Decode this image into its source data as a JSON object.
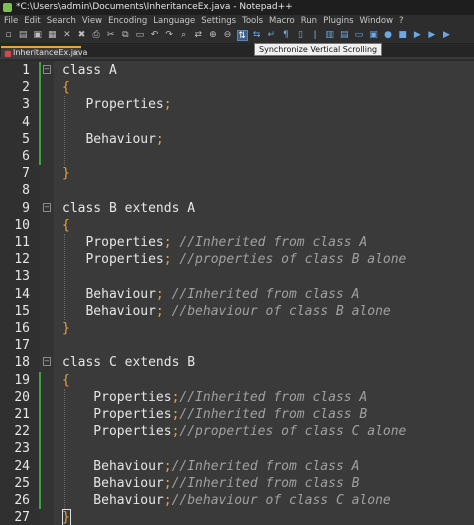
{
  "window": {
    "title": "*C:\\Users\\admin\\Documents\\InheritanceEx.java - Notepad++"
  },
  "menu": [
    "File",
    "Edit",
    "Search",
    "View",
    "Encoding",
    "Language",
    "Settings",
    "Tools",
    "Macro",
    "Run",
    "Plugins",
    "Window",
    "?"
  ],
  "tooltip": "Synchronize Vertical Scrolling",
  "tab": {
    "label": "InheritanceEx.java"
  },
  "colors": {
    "accent": "#e8a33d",
    "change_bar": "#3aa53a",
    "background": "#3a3a3a"
  },
  "lines": [
    {
      "n": "1",
      "fold": "minus",
      "tokens": [
        [
          "kw",
          "class A"
        ]
      ]
    },
    {
      "n": "2",
      "fold": "",
      "tokens": [
        [
          "br",
          "{"
        ]
      ]
    },
    {
      "n": "3",
      "fold": "",
      "tokens": [
        [
          "t",
          "   Properties"
        ],
        [
          "semi",
          ";"
        ]
      ]
    },
    {
      "n": "4",
      "fold": "",
      "tokens": []
    },
    {
      "n": "5",
      "fold": "",
      "tokens": [
        [
          "t",
          "   Behaviour"
        ],
        [
          "semi",
          ";"
        ]
      ]
    },
    {
      "n": "6",
      "fold": "",
      "tokens": []
    },
    {
      "n": "7",
      "fold": "",
      "tokens": [
        [
          "br",
          "}"
        ]
      ]
    },
    {
      "n": "8",
      "fold": "",
      "tokens": []
    },
    {
      "n": "9",
      "fold": "minus",
      "tokens": [
        [
          "kw",
          "class B extends A"
        ]
      ]
    },
    {
      "n": "10",
      "fold": "",
      "tokens": [
        [
          "br",
          "{"
        ]
      ]
    },
    {
      "n": "11",
      "fold": "",
      "tokens": [
        [
          "t",
          "   Properties"
        ],
        [
          "semi",
          ";"
        ],
        [
          "cm",
          " //Inherited from class A"
        ]
      ]
    },
    {
      "n": "12",
      "fold": "",
      "tokens": [
        [
          "t",
          "   Properties"
        ],
        [
          "semi",
          ";"
        ],
        [
          "cm",
          " //properties of class B alone"
        ]
      ]
    },
    {
      "n": "13",
      "fold": "",
      "tokens": []
    },
    {
      "n": "14",
      "fold": "",
      "tokens": [
        [
          "t",
          "   Behaviour"
        ],
        [
          "semi",
          ";"
        ],
        [
          "cm",
          " //Inherited from class A"
        ]
      ]
    },
    {
      "n": "15",
      "fold": "",
      "tokens": [
        [
          "t",
          "   Behaviour"
        ],
        [
          "semi",
          ";"
        ],
        [
          "cm",
          " //behaviour of class B alone"
        ]
      ]
    },
    {
      "n": "16",
      "fold": "",
      "tokens": [
        [
          "br",
          "}"
        ]
      ]
    },
    {
      "n": "17",
      "fold": "",
      "tokens": []
    },
    {
      "n": "18",
      "fold": "minus",
      "tokens": [
        [
          "kw",
          "class C extends B"
        ]
      ]
    },
    {
      "n": "19",
      "fold": "",
      "tokens": [
        [
          "br",
          "{"
        ]
      ]
    },
    {
      "n": "20",
      "fold": "",
      "tokens": [
        [
          "t",
          "    Properties"
        ],
        [
          "semi",
          ";"
        ],
        [
          "cm",
          "//Inherited from class A"
        ]
      ]
    },
    {
      "n": "21",
      "fold": "",
      "tokens": [
        [
          "t",
          "    Properties"
        ],
        [
          "semi",
          ";"
        ],
        [
          "cm",
          "//Inherited from class B"
        ]
      ]
    },
    {
      "n": "22",
      "fold": "",
      "tokens": [
        [
          "t",
          "    Properties"
        ],
        [
          "semi",
          ";"
        ],
        [
          "cm",
          "//properties of class C alone"
        ]
      ]
    },
    {
      "n": "23",
      "fold": "",
      "tokens": []
    },
    {
      "n": "24",
      "fold": "",
      "tokens": [
        [
          "t",
          "    Behaviour"
        ],
        [
          "semi",
          ";"
        ],
        [
          "cm",
          "//Inherited from class A"
        ]
      ]
    },
    {
      "n": "25",
      "fold": "",
      "tokens": [
        [
          "t",
          "    Behaviour"
        ],
        [
          "semi",
          ";"
        ],
        [
          "cm",
          "//Inherited from class B"
        ]
      ]
    },
    {
      "n": "26",
      "fold": "",
      "tokens": [
        [
          "t",
          "    Behaviour"
        ],
        [
          "semi",
          ";"
        ],
        [
          "cm",
          "//behaviour of class C alone"
        ]
      ]
    },
    {
      "n": "27",
      "fold": "",
      "tokens": [
        [
          "br",
          "}"
        ]
      ]
    }
  ],
  "toolbar_icons": [
    "new-file-icon",
    "open-file-icon",
    "save-icon",
    "save-all-icon",
    "close-icon",
    "close-all-icon",
    "print-icon",
    "cut-icon",
    "copy-icon",
    "paste-icon",
    "undo-icon",
    "redo-icon",
    "find-icon",
    "replace-icon",
    "zoom-in-icon",
    "zoom-out-icon",
    "sync-vertical-icon",
    "sync-horizontal-icon",
    "word-wrap-icon",
    "show-all-chars-icon",
    "indent-guide-icon",
    "user-lang-icon",
    "doc-map-icon",
    "function-list-icon",
    "folder-workspace-icon",
    "monitor-icon",
    "record-macro-icon",
    "stop-macro-icon",
    "play-macro-icon",
    "run-macro-icon",
    "save-macro-icon"
  ]
}
